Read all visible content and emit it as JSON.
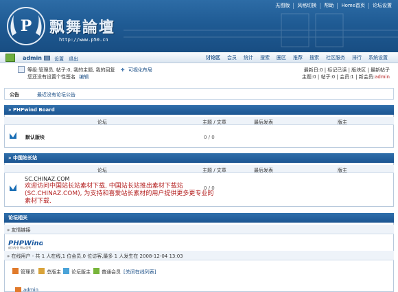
{
  "top_links": [
    "无图版",
    "风格切换",
    "帮助",
    "Home首页",
    "论坛设置"
  ],
  "site": {
    "title": "飘舞論壇",
    "url": "http://www.p50.cn",
    "emblem_text": "P"
  },
  "user": {
    "name": "admin",
    "links": [
      "设置",
      "退出"
    ]
  },
  "nav_menu": [
    {
      "label": "讨论区",
      "active": true
    },
    {
      "label": "会员",
      "active": false
    },
    {
      "label": "统计",
      "active": false
    },
    {
      "label": "搜索",
      "active": false
    },
    {
      "label": "圈区",
      "active": false
    },
    {
      "label": "推荐",
      "active": false
    },
    {
      "label": "搜索",
      "active": false
    },
    {
      "label": "社区服务",
      "active": false
    },
    {
      "label": "排行",
      "active": false
    },
    {
      "label": "系统设置",
      "active": false
    }
  ],
  "userinfo": {
    "line1": "等级:管理员, 帖子:0, 我的主题, 我的回复",
    "line1_extra": "可视化布局",
    "line2": "您还没有设置个性签名",
    "line2_link": "编辑",
    "right1": "最新日:0 | 标记已读 | 版块区 | 最新帖子",
    "right2": "主题:0 | 帖子:0 | 会员:1 | 新会员:",
    "right2_member": "admin"
  },
  "notice": {
    "label": "公告",
    "text": "最近没有论坛公告"
  },
  "section1": {
    "title": "» PHPwind Board",
    "columns": [
      "论坛",
      "主题 / 文章",
      "最后发表",
      "版主"
    ],
    "forums": [
      {
        "name": "默认版块",
        "stats": "0 / 0"
      }
    ]
  },
  "section2": {
    "title": "» 中国站长站",
    "columns": [
      "论坛",
      "主题 / 文章",
      "最后发表",
      "版主"
    ],
    "forum_url": "SC.CHINAZ.COM",
    "forum_desc": "欢迎访问中国站长站素材下载, 中国站长站推出素材下载站(SC.CHINAZ.COM), 为支持和喜爱站长素材的用户提供更多更专业的素材下载.",
    "stats": "0 / 0"
  },
  "section3": {
    "title": "论坛相关",
    "friend_links": "» 友情链接",
    "phpwind_logo": "PHPWind",
    "phpwind_sub": "成为专业 所以优秀",
    "online": "» 在线用户  - 共  1 人在线,1 位会员,0 位访客,最多  1 人发生在  2008-12-04 13:03",
    "legend": [
      "管理员",
      "总版主",
      "论坛版主",
      "普通会员"
    ],
    "legend_link": "[关闭在线列表]",
    "online_user": "admin"
  },
  "colors": {
    "header_blue": "#1f5b94",
    "link_blue": "#1a4e86",
    "forum_desc_red": "#b42020"
  }
}
